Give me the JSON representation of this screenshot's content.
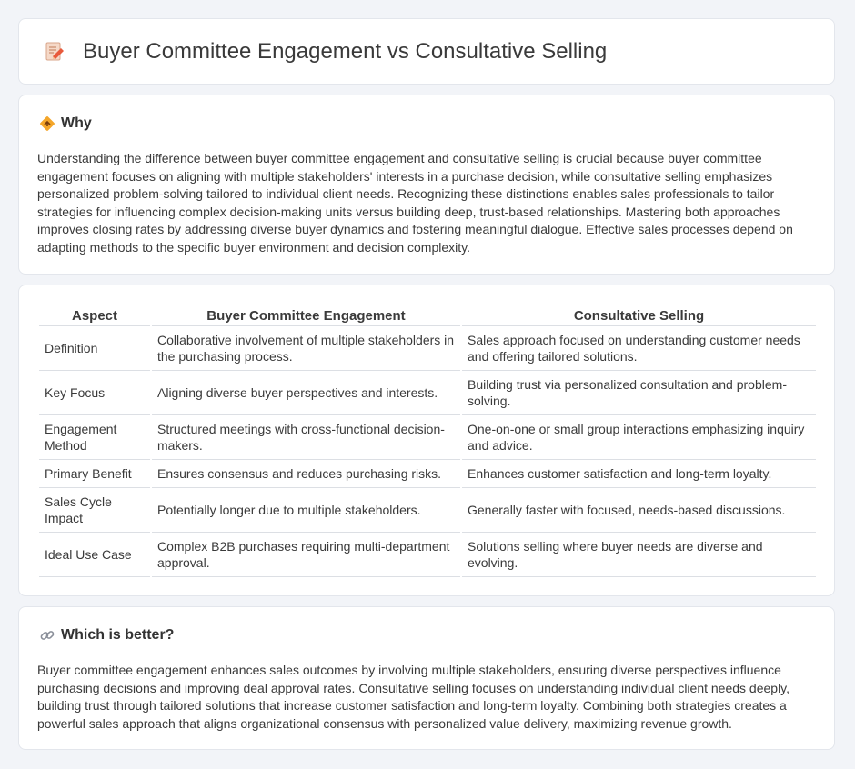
{
  "header": {
    "title": "Buyer Committee Engagement vs Consultative Selling",
    "icon": "document-pen-icon"
  },
  "why": {
    "icon": "diamond-sign-icon",
    "heading": "Why",
    "text": "Understanding the difference between buyer committee engagement and consultative selling is crucial because buyer committee engagement focuses on aligning with multiple stakeholders' interests in a purchase decision, while consultative selling emphasizes personalized problem-solving tailored to individual client needs. Recognizing these distinctions enables sales professionals to tailor strategies for influencing complex decision-making units versus building deep, trust-based relationships. Mastering both approaches improves closing rates by addressing diverse buyer dynamics and fostering meaningful dialogue. Effective sales processes depend on adapting methods to the specific buyer environment and decision complexity."
  },
  "table": {
    "headers": [
      "Aspect",
      "Buyer Committee Engagement",
      "Consultative Selling"
    ],
    "rows": [
      [
        "Definition",
        "Collaborative involvement of multiple stakeholders in the purchasing process.",
        "Sales approach focused on understanding customer needs and offering tailored solutions."
      ],
      [
        "Key Focus",
        "Aligning diverse buyer perspectives and interests.",
        "Building trust via personalized consultation and problem-solving."
      ],
      [
        "Engagement Method",
        "Structured meetings with cross-functional decision-makers.",
        "One-on-one or small group interactions emphasizing inquiry and advice."
      ],
      [
        "Primary Benefit",
        "Ensures consensus and reduces purchasing risks.",
        "Enhances customer satisfaction and long-term loyalty."
      ],
      [
        "Sales Cycle Impact",
        "Potentially longer due to multiple stakeholders.",
        "Generally faster with focused, needs-based discussions."
      ],
      [
        "Ideal Use Case",
        "Complex B2B purchases requiring multi-department approval.",
        "Solutions selling where buyer needs are diverse and evolving."
      ]
    ]
  },
  "better": {
    "icon": "link-icon",
    "heading": "Which is better?",
    "text": "Buyer committee engagement enhances sales outcomes by involving multiple stakeholders, ensuring diverse perspectives influence purchasing decisions and improving deal approval rates. Consultative selling focuses on understanding individual client needs deeply, building trust through tailored solutions that increase customer satisfaction and long-term loyalty. Combining both strategies creates a powerful sales approach that aligns organizational consensus with personalized value delivery, maximizing revenue growth."
  }
}
